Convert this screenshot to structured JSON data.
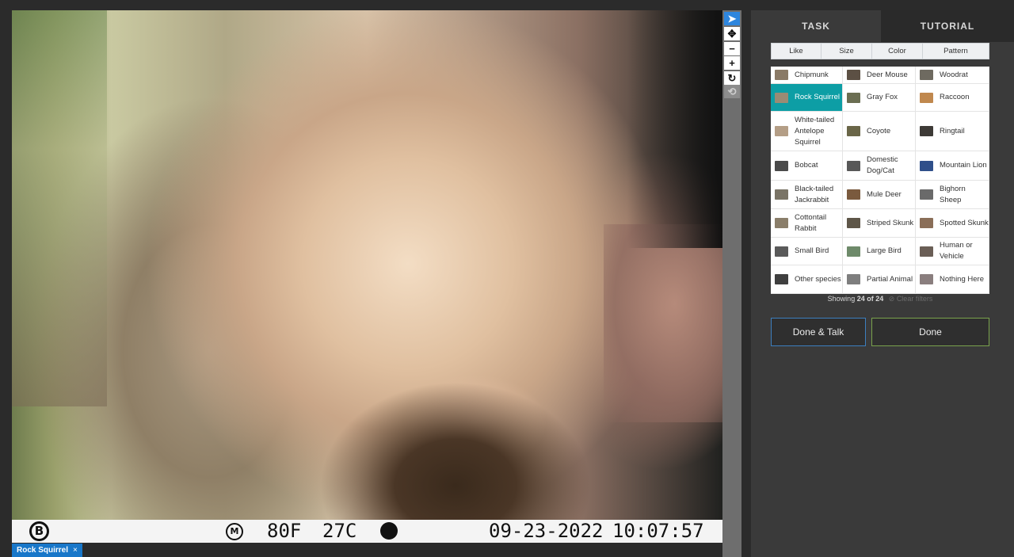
{
  "viewer": {
    "stamp": {
      "logo": "B",
      "moon": "M",
      "temp_f": "80F",
      "temp_c": "27C",
      "date": "09-23-2022",
      "time": "10:07:57"
    },
    "tag": {
      "label": "Rock Squirrel",
      "remove": "×"
    }
  },
  "toolbar": {
    "buttons": [
      {
        "icon": "pointer-icon",
        "glyph": "➤"
      },
      {
        "icon": "move-icon",
        "glyph": "✥"
      },
      {
        "icon": "zoom-out-icon",
        "glyph": "−"
      },
      {
        "icon": "zoom-in-icon",
        "glyph": "+"
      },
      {
        "icon": "rotate-icon",
        "glyph": "↻"
      },
      {
        "icon": "reset-icon",
        "glyph": "⟲"
      }
    ]
  },
  "panel": {
    "tabs": {
      "task": "TASK",
      "tutorial": "TUTORIAL"
    },
    "filters": [
      "Like",
      "Size",
      "Color",
      "Pattern"
    ],
    "species": [
      [
        "Chipmunk",
        "Deer Mouse",
        "Woodrat"
      ],
      [
        "Rock Squirrel",
        "Gray Fox",
        "Raccoon"
      ],
      [
        "White-tailed Antelope Squirrel",
        "Coyote",
        "Ringtail"
      ],
      [
        "Bobcat",
        "Domestic Dog/Cat",
        "Mountain Lion"
      ],
      [
        "Black-tailed Jackrabbit",
        "Mule Deer",
        "Bighorn Sheep"
      ],
      [
        "Cottontail Rabbit",
        "Striped Skunk",
        "Spotted Skunk"
      ],
      [
        "Small Bird",
        "Large Bird",
        "Human or Vehicle"
      ],
      [
        "Other species",
        "Partial Animal",
        "Nothing Here"
      ]
    ],
    "selected": "Rock Squirrel",
    "selected_color": "#0d9ea5",
    "showing": {
      "prefix": "Showing",
      "text": "24 of 24",
      "clear": "Clear filters"
    },
    "buttons": {
      "done_talk": "Done & Talk",
      "done": "Done"
    }
  }
}
